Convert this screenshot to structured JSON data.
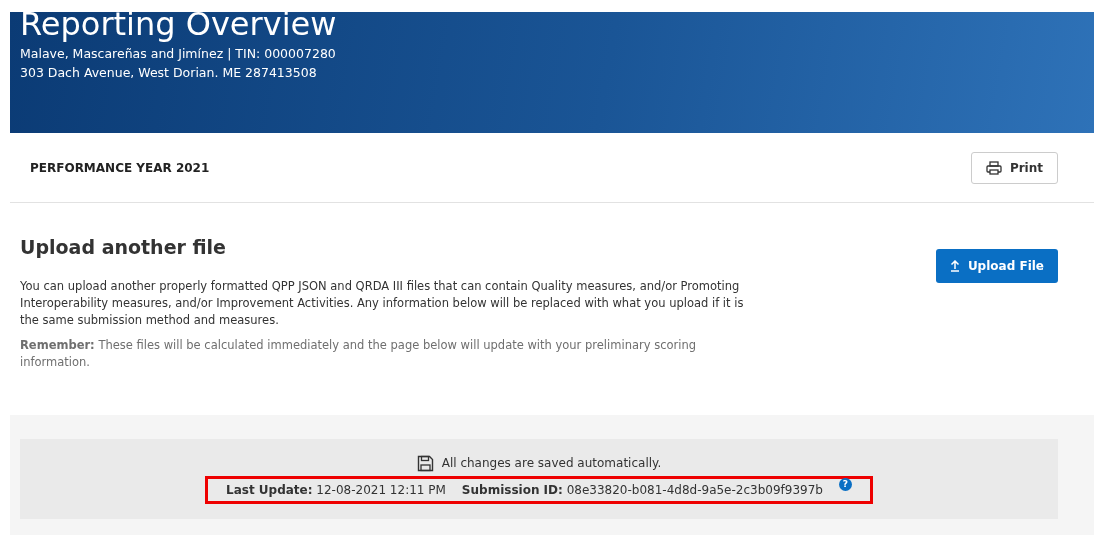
{
  "header": {
    "title": "Reporting Overview",
    "organization": "Malave, Mascareñas and Jimínez | TIN: 000007280",
    "address": "303 Dach Avenue, West Dorian. ME 287413508"
  },
  "performance_year": {
    "label": "PERFORMANCE YEAR 2021",
    "print_button": "Print"
  },
  "upload": {
    "heading": "Upload another file",
    "button": "Upload File",
    "description": "You can upload another properly formatted QPP JSON and QRDA III files that can contain Quality measures, and/or Promoting Interoperability measures, and/or Improvement Activities. Any information below will be replaced with what you upload if it is the same submission method and measures.",
    "reminder": "**Remember:** These files will be calculated immediately and the page below will update with your preliminary scoring information."
  },
  "footer": {
    "saved_note": "All changes are saved automatically.",
    "highlighted": true,
    "last_update": "**Last Update:** 12-08-2021 12:11 PM",
    "submission_id": "**Submission ID:** 08e33820-b081-4d8d-9a5e-2c3b09f9397b",
    "help_icon": "?"
  }
}
